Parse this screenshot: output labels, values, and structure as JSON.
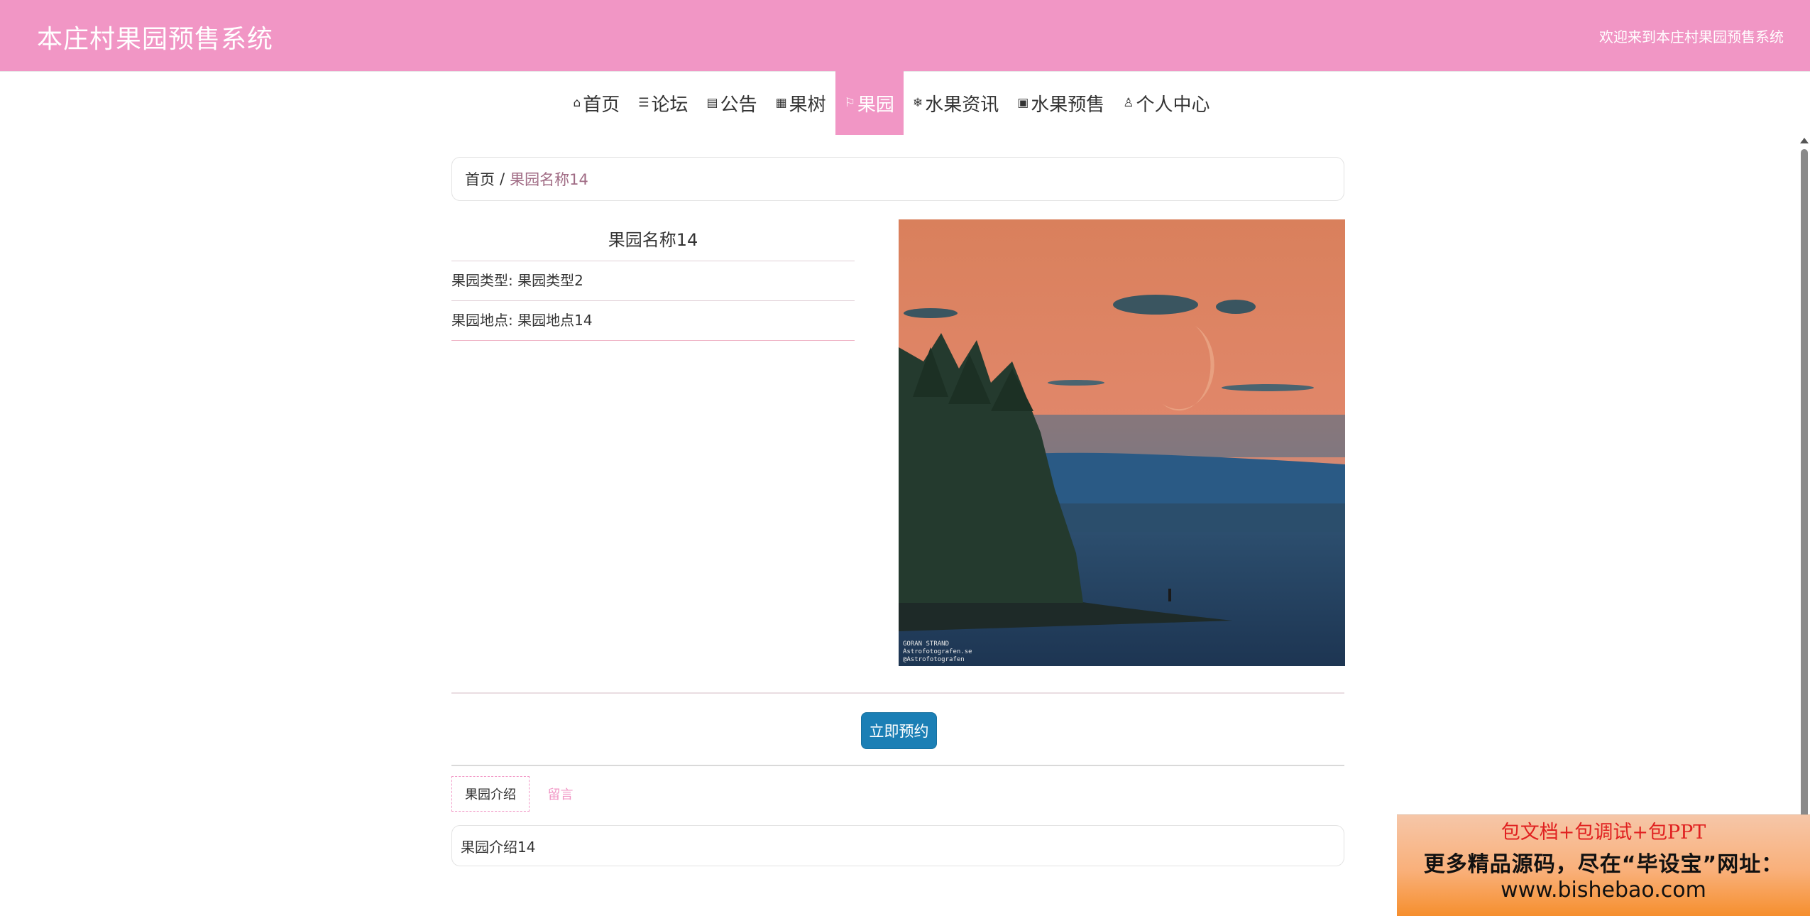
{
  "header": {
    "title": "本庄村果园预售系统",
    "welcome": "欢迎来到本庄村果园预售系统"
  },
  "nav": {
    "items": [
      {
        "label": "首页",
        "icon": "home-icon",
        "glyph": "⌂"
      },
      {
        "label": "论坛",
        "icon": "layers-icon",
        "glyph": "☰"
      },
      {
        "label": "公告",
        "icon": "notice-icon",
        "glyph": "▤"
      },
      {
        "label": "果树",
        "icon": "grid-icon",
        "glyph": "▦"
      },
      {
        "label": "果园",
        "icon": "flag-icon",
        "glyph": "⚐"
      },
      {
        "label": "水果资讯",
        "icon": "snowflake-icon",
        "glyph": "❄"
      },
      {
        "label": "水果预售",
        "icon": "apps-icon",
        "glyph": "▣"
      },
      {
        "label": "个人中心",
        "icon": "user-icon",
        "glyph": "♙"
      }
    ],
    "active_index": 4
  },
  "breadcrumb": {
    "home": "首页",
    "separator": "/",
    "current": "果园名称14"
  },
  "detail": {
    "name": "果园名称14",
    "type_line": "果园类型: 果园类型2",
    "location_line": "果园地点: 果园地点14",
    "image_watermark": [
      "GORAN STRAND",
      "Astrofotografen.se",
      "@Astrofotografen"
    ]
  },
  "actions": {
    "reserve_label": "立即预约"
  },
  "tabs": {
    "intro": "果园介绍",
    "comment": "留言"
  },
  "intro_content": "果园介绍14",
  "ad": {
    "line1": "包文档+包调试+包PPT",
    "line2": "更多精品源码，尽在“毕设宝”网址：",
    "line3": "www.bishebao.com"
  },
  "colors": {
    "accent": "#f196c5",
    "button": "#1b7fb5"
  }
}
